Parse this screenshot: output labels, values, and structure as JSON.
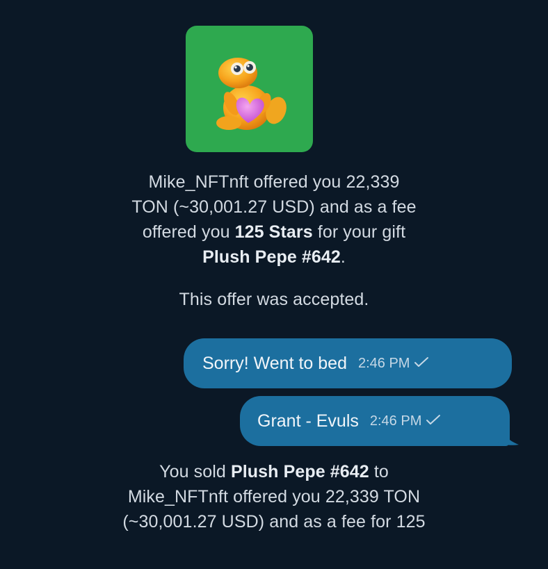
{
  "gift": {
    "icon": "plush-pepe-frog-holding-heart",
    "tile_color": "#2ea94f"
  },
  "offer_service": {
    "line1": "Mike_NFTnft offered you 22,339",
    "line2": "TON (~30,001.27 USD) and as a fee",
    "line3_pre": "offered you ",
    "line3_bold": "125 Stars",
    "line3_post": " for your gift",
    "line4_bold": "Plush Pepe #642",
    "line4_post": "."
  },
  "accepted_service": "This offer was accepted.",
  "messages": [
    {
      "text": "Sorry! Went to bed",
      "time": "2:46 PM",
      "status_icon": "double-check-icon"
    },
    {
      "text": "Grant - Evuls",
      "time": "2:46 PM",
      "status_icon": "double-check-icon"
    }
  ],
  "sold_service": {
    "line1_pre": "You sold ",
    "line1_bold": "Plush Pepe #642",
    "line1_post": " to",
    "line2": "Mike_NFTnft offered you 22,339 TON",
    "line3": "(~30,001.27 USD) and as a fee for 125"
  },
  "colors": {
    "background": "#0b1826",
    "outgoing_bubble": "#1c6f9f",
    "service_text": "#d3dae2"
  }
}
